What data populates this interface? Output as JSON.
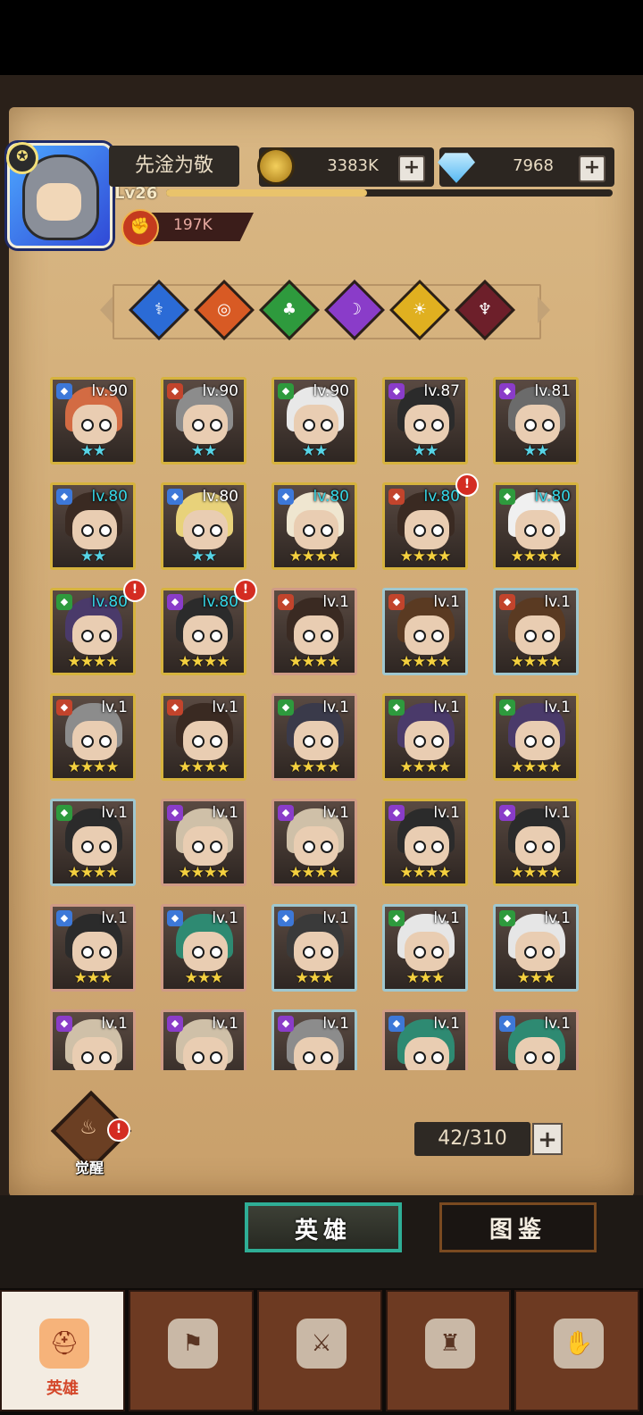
{
  "player": {
    "name": "先淦为敬",
    "level": "Lv26",
    "xp_fraction": 0.45,
    "power": "197K"
  },
  "resources": {
    "gold": "3383K",
    "gems": "7968"
  },
  "filters": [
    {
      "name": "priest-filter",
      "glyph": "⚕",
      "color": "#2b6bd6"
    },
    {
      "name": "warrior-filter",
      "glyph": "◎",
      "color": "#d85a24"
    },
    {
      "name": "nature-filter",
      "glyph": "♣",
      "color": "#2e9a3d"
    },
    {
      "name": "mage-filter",
      "glyph": "☽",
      "color": "#8a3cc9"
    },
    {
      "name": "holy-filter",
      "glyph": "☀",
      "color": "#e0b020"
    },
    {
      "name": "dark-filter",
      "glyph": "♆",
      "color": "#6d1f2a"
    }
  ],
  "heroes": [
    {
      "lv": "lv.90",
      "stars": "★★",
      "star_color": "blue",
      "frame": "gold",
      "cls": "#3d78d8",
      "hair": "#d36b43",
      "hi": false,
      "alert": false
    },
    {
      "lv": "lv.90",
      "stars": "★★",
      "star_color": "blue",
      "frame": "gold",
      "cls": "#c2442c",
      "hair": "#8c8c8c",
      "hi": false,
      "alert": false
    },
    {
      "lv": "lv.90",
      "stars": "★★",
      "star_color": "blue",
      "frame": "gold",
      "cls": "#2e9a3d",
      "hair": "#e8e8e8",
      "hi": false,
      "alert": false
    },
    {
      "lv": "lv.87",
      "stars": "★★",
      "star_color": "blue",
      "frame": "gold",
      "cls": "#8a3cc9",
      "hair": "#2b2b2b",
      "hi": false,
      "alert": false
    },
    {
      "lv": "lv.81",
      "stars": "★★",
      "star_color": "blue",
      "frame": "gold",
      "cls": "#8a3cc9",
      "hair": "#6b6b6b",
      "hi": false,
      "alert": false
    },
    {
      "lv": "lv.80",
      "stars": "★★",
      "star_color": "blue",
      "frame": "gold",
      "cls": "#3d78d8",
      "hair": "#3a2a22",
      "hi": true,
      "alert": false
    },
    {
      "lv": "lv.80",
      "stars": "★★",
      "star_color": "blue",
      "frame": "gold",
      "cls": "#3d78d8",
      "hair": "#e8d27a",
      "hi": false,
      "alert": false
    },
    {
      "lv": "lv.80",
      "stars": "★★★★",
      "star_color": "gold",
      "frame": "gold",
      "cls": "#3d78d8",
      "hair": "#efe6d0",
      "hi": true,
      "alert": false
    },
    {
      "lv": "lv.80",
      "stars": "★★★★",
      "star_color": "gold",
      "frame": "gold",
      "cls": "#c2442c",
      "hair": "#3a2a22",
      "hi": true,
      "alert": true
    },
    {
      "lv": "lv.80",
      "stars": "★★★★",
      "star_color": "gold",
      "frame": "gold",
      "cls": "#2e9a3d",
      "hair": "#f0f0f0",
      "hi": true,
      "alert": false
    },
    {
      "lv": "lv.80",
      "stars": "★★★★",
      "star_color": "gold",
      "frame": "gold",
      "cls": "#2e9a3d",
      "hair": "#4a3a6a",
      "hi": true,
      "alert": true
    },
    {
      "lv": "lv.80",
      "stars": "★★★★",
      "star_color": "gold",
      "frame": "gold",
      "cls": "#8a3cc9",
      "hair": "#2b2b2b",
      "hi": true,
      "alert": true
    },
    {
      "lv": "lv.1",
      "stars": "★★★★",
      "star_color": "gold",
      "frame": "pink",
      "cls": "#c2442c",
      "hair": "#3a2a22",
      "hi": false,
      "alert": false
    },
    {
      "lv": "lv.1",
      "stars": "★★★★",
      "star_color": "gold",
      "frame": "blue",
      "cls": "#c2442c",
      "hair": "#5a3a22",
      "hi": false,
      "alert": false
    },
    {
      "lv": "lv.1",
      "stars": "★★★★",
      "star_color": "gold",
      "frame": "blue",
      "cls": "#c2442c",
      "hair": "#5a3a22",
      "hi": false,
      "alert": false
    },
    {
      "lv": "lv.1",
      "stars": "★★★★",
      "star_color": "gold",
      "frame": "gold",
      "cls": "#c2442c",
      "hair": "#8c8c8c",
      "hi": false,
      "alert": false
    },
    {
      "lv": "lv.1",
      "stars": "★★★★",
      "star_color": "gold",
      "frame": "gold",
      "cls": "#c2442c",
      "hair": "#3a2a22",
      "hi": false,
      "alert": false
    },
    {
      "lv": "lv.1",
      "stars": "★★★★",
      "star_color": "gold",
      "frame": "pink",
      "cls": "#2e9a3d",
      "hair": "#3a3a4a",
      "hi": false,
      "alert": false
    },
    {
      "lv": "lv.1",
      "stars": "★★★★",
      "star_color": "gold",
      "frame": "gold",
      "cls": "#2e9a3d",
      "hair": "#4a3a6a",
      "hi": false,
      "alert": false
    },
    {
      "lv": "lv.1",
      "stars": "★★★★",
      "star_color": "gold",
      "frame": "gold",
      "cls": "#2e9a3d",
      "hair": "#4a3a6a",
      "hi": false,
      "alert": false
    },
    {
      "lv": "lv.1",
      "stars": "★★★★",
      "star_color": "gold",
      "frame": "blue",
      "cls": "#2e9a3d",
      "hair": "#2b2b2b",
      "hi": false,
      "alert": false
    },
    {
      "lv": "lv.1",
      "stars": "★★★★",
      "star_color": "gold",
      "frame": "pink",
      "cls": "#8a3cc9",
      "hair": "#cfc0a8",
      "hi": false,
      "alert": false
    },
    {
      "lv": "lv.1",
      "stars": "★★★★",
      "star_color": "gold",
      "frame": "pink",
      "cls": "#8a3cc9",
      "hair": "#cfc0a8",
      "hi": false,
      "alert": false
    },
    {
      "lv": "lv.1",
      "stars": "★★★★",
      "star_color": "gold",
      "frame": "gold",
      "cls": "#8a3cc9",
      "hair": "#2b2b2b",
      "hi": false,
      "alert": false
    },
    {
      "lv": "lv.1",
      "stars": "★★★★",
      "star_color": "gold",
      "frame": "gold",
      "cls": "#8a3cc9",
      "hair": "#2b2b2b",
      "hi": false,
      "alert": false
    },
    {
      "lv": "lv.1",
      "stars": "★★★",
      "star_color": "gold",
      "frame": "pink",
      "cls": "#3d78d8",
      "hair": "#2b2b2b",
      "hi": false,
      "alert": false
    },
    {
      "lv": "lv.1",
      "stars": "★★★",
      "star_color": "gold",
      "frame": "pink",
      "cls": "#3d78d8",
      "hair": "#2e8a72",
      "hi": false,
      "alert": false
    },
    {
      "lv": "lv.1",
      "stars": "★★★",
      "star_color": "gold",
      "frame": "blue",
      "cls": "#3d78d8",
      "hair": "#3a3a3a",
      "hi": false,
      "alert": false
    },
    {
      "lv": "lv.1",
      "stars": "★★★",
      "star_color": "gold",
      "frame": "blue",
      "cls": "#2e9a3d",
      "hair": "#e6e6e6",
      "hi": false,
      "alert": false
    },
    {
      "lv": "lv.1",
      "stars": "★★★",
      "star_color": "gold",
      "frame": "blue",
      "cls": "#2e9a3d",
      "hair": "#e6e6e6",
      "hi": false,
      "alert": false
    },
    {
      "lv": "lv.1",
      "stars": "",
      "star_color": "gold",
      "frame": "pink",
      "cls": "#8a3cc9",
      "hair": "#cfc0a8",
      "hi": false,
      "alert": false
    },
    {
      "lv": "lv.1",
      "stars": "",
      "star_color": "gold",
      "frame": "pink",
      "cls": "#8a3cc9",
      "hair": "#cfc0a8",
      "hi": false,
      "alert": false
    },
    {
      "lv": "lv.1",
      "stars": "",
      "star_color": "gold",
      "frame": "blue",
      "cls": "#8a3cc9",
      "hair": "#8c8c8c",
      "hi": false,
      "alert": false
    },
    {
      "lv": "lv.1",
      "stars": "",
      "star_color": "gold",
      "frame": "pink",
      "cls": "#3d78d8",
      "hair": "#2e8a72",
      "hi": false,
      "alert": false
    },
    {
      "lv": "lv.1",
      "stars": "",
      "star_color": "gold",
      "frame": "pink",
      "cls": "#3d78d8",
      "hair": "#2e8a72",
      "hi": false,
      "alert": false
    }
  ],
  "awaken": {
    "label": "觉醒"
  },
  "hero_count": "42/310",
  "tabs": {
    "heroes": "英雄",
    "codex": "图鉴"
  },
  "nav": [
    {
      "name": "nav-heroes",
      "label": "英雄",
      "glyph": "⛑",
      "active": true
    },
    {
      "name": "nav-guild",
      "label": "",
      "glyph": "⚑",
      "active": false
    },
    {
      "name": "nav-battle",
      "label": "",
      "glyph": "⚔",
      "active": false
    },
    {
      "name": "nav-tower",
      "label": "",
      "glyph": "♜",
      "active": false
    },
    {
      "name": "nav-alliance",
      "label": "",
      "glyph": "✋",
      "active": false
    }
  ],
  "alert_mark": "!"
}
